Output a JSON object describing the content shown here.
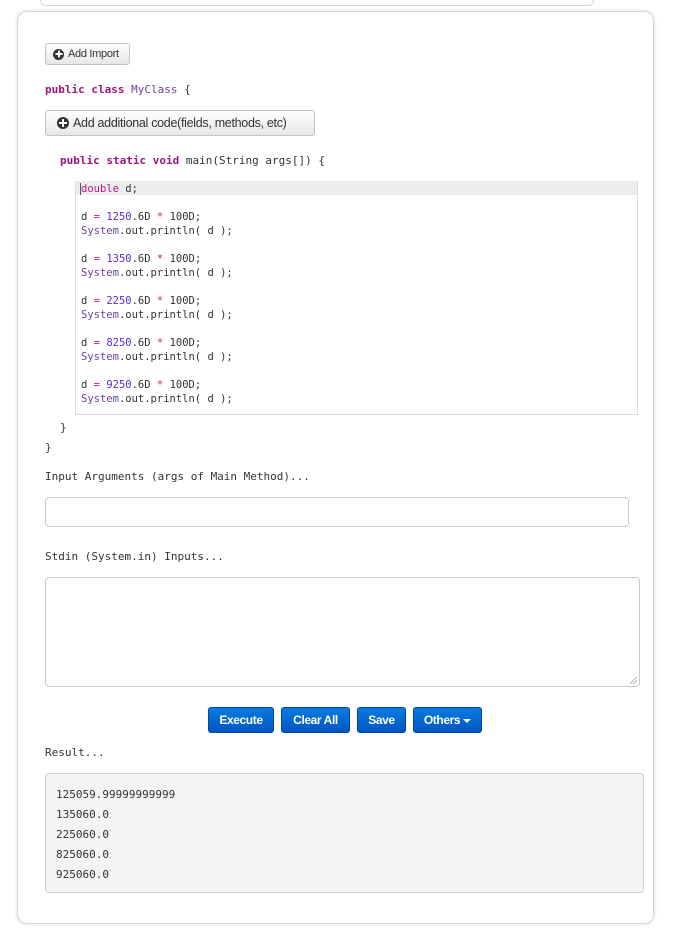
{
  "toolbar": {
    "add_import_label": "Add Import",
    "add_code_label": "Add additional code(fields, methods, etc)"
  },
  "code": {
    "class_decl": {
      "kw1": "public",
      "kw2": "class",
      "name": "MyClass",
      "brace": "{"
    },
    "main_decl": {
      "kw1": "public",
      "kw2": "static",
      "kw3": "void",
      "sig": "main(String args[]) {"
    },
    "editor_lines": [
      {
        "type": "decl",
        "kw": "double",
        "rest": " d;"
      },
      {
        "type": "assign",
        "var": "d",
        "eq": "=",
        "num": "1250",
        "suffix": ".6D",
        "op": "*",
        "rhs": "100D;"
      },
      {
        "type": "print",
        "cls": "System",
        "rest": ".out.println( d );"
      },
      {
        "type": "assign",
        "var": "d",
        "eq": "=",
        "num": "1350",
        "suffix": ".6D",
        "op": "*",
        "rhs": "100D;"
      },
      {
        "type": "print",
        "cls": "System",
        "rest": ".out.println( d );"
      },
      {
        "type": "assign",
        "var": "d",
        "eq": "=",
        "num": "2250",
        "suffix": ".6D",
        "op": "*",
        "rhs": "100D;"
      },
      {
        "type": "print",
        "cls": "System",
        "rest": ".out.println( d );"
      },
      {
        "type": "assign",
        "var": "d",
        "eq": "=",
        "num": "8250",
        "suffix": ".6D",
        "op": "*",
        "rhs": "100D;"
      },
      {
        "type": "print",
        "cls": "System",
        "rest": ".out.println( d );"
      },
      {
        "type": "assign",
        "var": "d",
        "eq": "=",
        "num": "9250",
        "suffix": ".6D",
        "op": "*",
        "rhs": "100D;"
      },
      {
        "type": "print",
        "cls": "System",
        "rest": ".out.println( d );"
      }
    ],
    "inner_close": "}",
    "outer_close": "}"
  },
  "inputs": {
    "args_label": "Input Arguments (args of Main Method)...",
    "args_value": "",
    "stdin_label": "Stdin (System.in) Inputs...",
    "stdin_value": ""
  },
  "actions": {
    "execute": "Execute",
    "clear_all": "Clear All",
    "save": "Save",
    "others": "Others"
  },
  "result": {
    "label": "Result...",
    "lines": [
      "125059.99999999999",
      "135060.0",
      "225060.0",
      "825060.0",
      "925060.0"
    ]
  },
  "colors": {
    "keyword": "#a0137c",
    "number": "#5a2bd6",
    "primary_button": "#0a6fd8"
  }
}
